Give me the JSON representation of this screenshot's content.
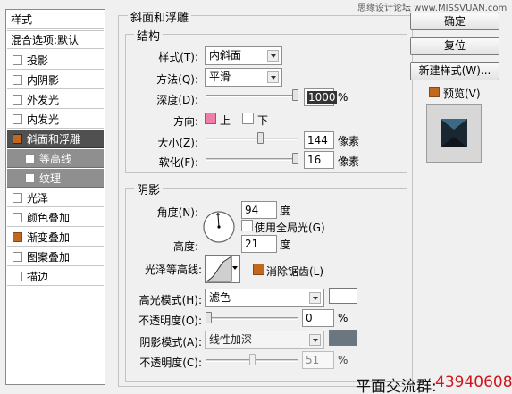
{
  "styles_panel": {
    "header": "样式",
    "blend": "混合选项:默认",
    "items": [
      {
        "label": "投影",
        "checked": false
      },
      {
        "label": "内阴影",
        "checked": false
      },
      {
        "label": "外发光",
        "checked": false
      },
      {
        "label": "内发光",
        "checked": false
      },
      {
        "label": "斜面和浮雕",
        "checked": true,
        "selected": true
      },
      {
        "label": "等高线",
        "checked": false,
        "sub": true
      },
      {
        "label": "纹理",
        "checked": false,
        "sub": true
      },
      {
        "label": "光泽",
        "checked": false
      },
      {
        "label": "颜色叠加",
        "checked": false
      },
      {
        "label": "渐变叠加",
        "checked": true
      },
      {
        "label": "图案叠加",
        "checked": false
      },
      {
        "label": "描边",
        "checked": false
      }
    ]
  },
  "bevel": {
    "title": "斜面和浮雕",
    "structure": {
      "title": "结构",
      "style_label": "样式(T):",
      "style_value": "内斜面",
      "technique_label": "方法(Q):",
      "technique_value": "平滑",
      "depth_label": "深度(D):",
      "depth_value": "1000",
      "depth_unit": "%",
      "depth_fraction": 1.0,
      "direction_label": "方向:",
      "direction_up": "上",
      "direction_down": "下",
      "size_label": "大小(Z):",
      "size_value": "144",
      "size_unit": "像素",
      "size_fraction": 0.6,
      "soften_label": "软化(F):",
      "soften_value": "16",
      "soften_unit": "像素",
      "soften_fraction": 1.0
    },
    "shading": {
      "title": "阴影",
      "angle_label": "角度(N):",
      "angle_value": "94",
      "angle_unit": "度",
      "global_light_label": "使用全局光(G)",
      "altitude_label": "高度:",
      "altitude_value": "21",
      "altitude_unit": "度",
      "gloss_label": "光泽等高线:",
      "antialias_label": "消除锯齿(L)",
      "highlight_mode_label": "高光模式(H):",
      "highlight_mode_value": "滤色",
      "highlight_color": "#ffffff",
      "highlight_opacity_label": "不透明度(O):",
      "highlight_opacity_value": "0",
      "highlight_opacity_fraction": 0.0,
      "shadow_mode_label": "阴影模式(A):",
      "shadow_mode_value": "线性加深",
      "shadow_color": "#6a7680",
      "shadow_opacity_label": "不透明度(C):",
      "shadow_opacity_value": "51",
      "shadow_opacity_fraction": 0.51,
      "percent": "%"
    }
  },
  "buttons": {
    "ok": "确定",
    "reset": "复位",
    "new_style": "新建样式(W)...",
    "preview_label": "预览(V)"
  },
  "watermark": {
    "top": "思缘设计论坛 www.MISSVUAN.com",
    "bottom_label": "平面交流群:",
    "bottom_number": "43940608"
  }
}
